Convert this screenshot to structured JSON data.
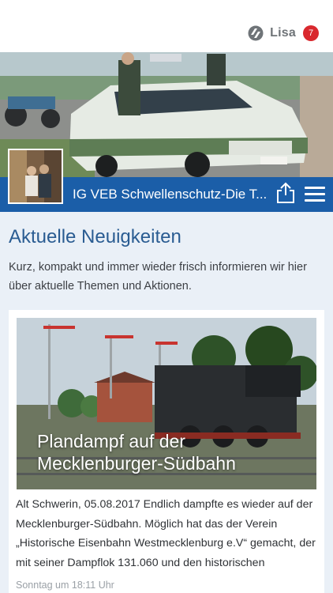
{
  "topbar": {
    "logo_icon": "app-logo-icon",
    "user_name": "Lisa",
    "notification_count": "7"
  },
  "group": {
    "title": "IG VEB Schwellenschutz-Die T...",
    "share_icon": "share-icon",
    "menu_icon": "hamburger-menu-icon"
  },
  "news": {
    "heading": "Aktuelle Neuigkeiten",
    "description": "Kurz, kompakt und immer wieder frisch informieren wir hier über aktuelle Themen und Aktionen."
  },
  "article": {
    "title": "Plandampf auf der Mecklenburger-Südbahn",
    "body": "Alt Schwerin, 05.08.2017 Endlich dampfte es wieder auf der Mecklenburger-Südbahn. Möglich hat das der Verein „Historische Eisenbahn Westmecklenburg e.V“ gemacht, der mit seiner Dampflok 131.060 und den historischen",
    "date": "Sonntag um 18:11 Uhr"
  },
  "colors": {
    "brand_blue": "#1b5ea8",
    "heading_blue": "#2a5c92",
    "badge_red": "#d9282e",
    "page_bg": "#eaf0f7"
  }
}
